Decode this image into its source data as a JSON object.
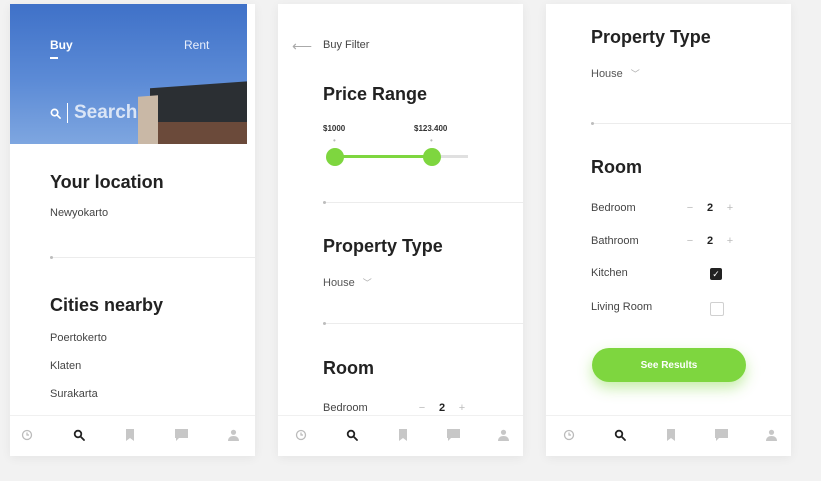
{
  "screen1": {
    "hero": {
      "tab_buy": "Buy",
      "tab_rent": "Rent",
      "search_placeholder": "Search"
    },
    "location": {
      "title": "Your location",
      "value": "Newyokarto"
    },
    "cities": {
      "title": "Cities nearby",
      "items": [
        "Poertokerto",
        "Klaten",
        "Surakarta"
      ]
    }
  },
  "screen2": {
    "header_title": "Buy Filter",
    "price": {
      "title": "Price Range",
      "min_label": "$1000",
      "max_label": "$123.400"
    },
    "property": {
      "title": "Property Type",
      "selected": "House"
    },
    "room": {
      "title": "Room",
      "bedroom_label": "Bedroom",
      "bedroom_value": "2"
    }
  },
  "screen3": {
    "property": {
      "title": "Property Type",
      "selected": "House"
    },
    "room": {
      "title": "Room",
      "bedroom_label": "Bedroom",
      "bedroom_value": "2",
      "bathroom_label": "Bathroom",
      "bathroom_value": "2",
      "kitchen_label": "Kitchen",
      "kitchen_checked": true,
      "living_label": "Living Room",
      "living_checked": false
    },
    "cta_label": "See Results"
  },
  "nav_icons": [
    "clock-icon",
    "search-icon",
    "bookmark-icon",
    "chat-icon",
    "user-icon"
  ],
  "colors": {
    "accent": "#7ed63f",
    "hero_blue": "#4a7bcd",
    "text": "#222222"
  }
}
